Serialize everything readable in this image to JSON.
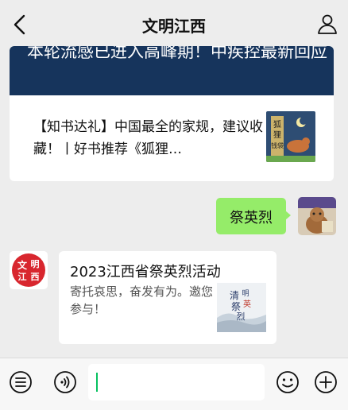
{
  "header": {
    "title": "文明江西"
  },
  "article_card": {
    "head_title": "本轮流感已进入高峰期！中疾控最新回应",
    "item_title": "【知书达礼】中国最全的家规，建议收藏！丨好书推荐《狐狸…",
    "thumb_text": "狐狸的钱袋"
  },
  "my_message": {
    "text": "祭英烈"
  },
  "bot_avatar": {
    "text": "文明江西"
  },
  "event_card": {
    "title": "2023江西省祭英烈活动",
    "description": "寄托哀思，奋发有为。邀您参与！",
    "thumb_text": "清明祭英烈"
  },
  "input": {
    "placeholder": ""
  },
  "colors": {
    "accent_green": "#95ec69",
    "header_navy": "#16345c",
    "cursor": "#07c160"
  },
  "icons": [
    "back-arrow-icon",
    "user-profile-icon",
    "menu-list-icon",
    "voice-icon",
    "emoji-icon",
    "plus-icon"
  ]
}
